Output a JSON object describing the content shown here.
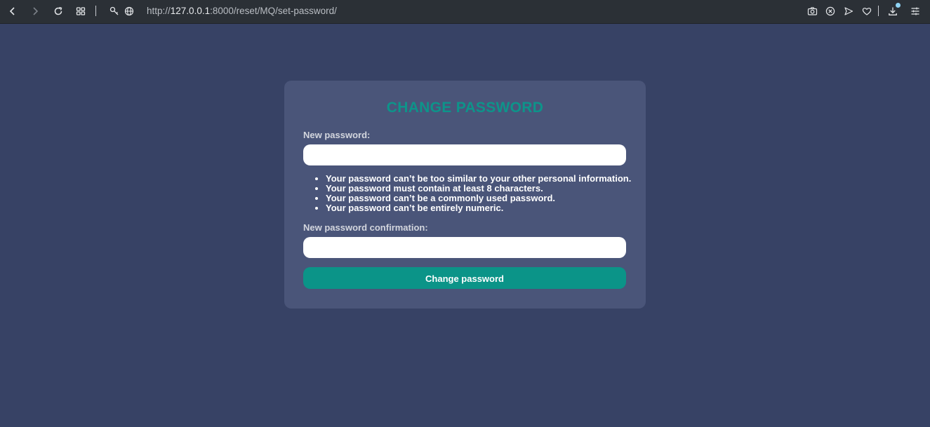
{
  "browser": {
    "url_prefix": "http://",
    "url_host": "127.0.0.1",
    "url_rest": ":8000/reset/MQ/set-password/",
    "icons": {
      "back": "back-arrow-icon",
      "forward": "forward-arrow-icon",
      "reload": "reload-icon",
      "tabs": "grid-icon",
      "key": "key-icon",
      "globe": "globe-icon",
      "camera": "camera-icon",
      "shield": "shield-icon",
      "send": "send-icon",
      "heart": "heart-icon",
      "download": "download-icon",
      "menu": "menu-icon"
    }
  },
  "form": {
    "title": "CHANGE PASSWORD",
    "new_password_label": "New password:",
    "new_password_value": "",
    "hints": [
      "Your password can’t be too similar to your other personal information.",
      "Your password must contain at least 8 characters.",
      "Your password can’t be a commonly used password.",
      "Your password can’t be entirely numeric."
    ],
    "confirm_label": "New password confirmation:",
    "confirm_value": "",
    "submit_label": "Change password"
  },
  "colors": {
    "page_bg": "#374265",
    "card_bg": "#4a5579",
    "accent": "#0b9488",
    "toolbar_bg": "#2b3036"
  }
}
